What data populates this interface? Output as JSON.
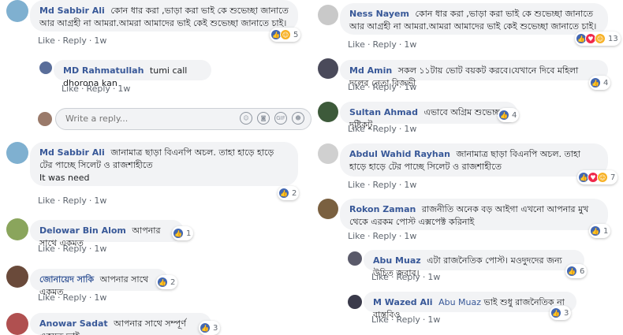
{
  "actions": {
    "like": "Like",
    "reply": "Reply",
    "dot": "·"
  },
  "colors": {
    "link": "#385898",
    "bubble": "#f2f3f5",
    "like_blue": "#4267b2"
  },
  "reply_box": {
    "placeholder": "Write a reply..."
  },
  "left": [
    {
      "author": "Md Sabbir Ali",
      "text": "কোন ধার করা ,ভাড়া করা ভাই কে শুভেচ্ছা জানাতে আর আগ্রহী না আমরা.আমরা আমাদের ভাই কেই শুভেচ্ছা জানাতে চাই।",
      "time": "1w",
      "reactions": "5",
      "icons": [
        "like-icon",
        "haha-icon"
      ]
    },
    {
      "author": "MD Rahmatullah",
      "text": "tumi call dhorona kan",
      "time": "1w"
    },
    {
      "author": "Md Sabbir Ali",
      "text": "জানামাত্র ছাড়া বিএনপি অচল. তাহা হাড়ে হাড়ে টের পাচ্ছে সিলেট ও রাজশাহীতে",
      "text2": "It was need",
      "time": "1w",
      "reactions": "2"
    },
    {
      "author": "Delowar Bin Alom",
      "text": "আপনার সাথে একমত",
      "time": "1w",
      "reactions": "1"
    },
    {
      "author": "জোনায়েদ সাকি",
      "text": "আপনার সাথে একমত",
      "time": "1w",
      "reactions": "2"
    },
    {
      "author": "Anowar Sadat",
      "text": "আপনার সাথে সম্পূর্ণ একমত ভাই...",
      "reactions": "3"
    }
  ],
  "right": [
    {
      "author": "Ness Nayem",
      "text": "কোন ধার করা ,ভাড়া করা ভাই কে শুভেচ্ছা জানাতে আর আগ্রহী না আমরা.আমরা আমাদের ভাই কেই শুভেচ্ছা জানাতে চাই।",
      "time": "1w",
      "reactions": "13",
      "icons": [
        "like-icon",
        "love-icon",
        "haha-icon"
      ]
    },
    {
      "author": "Md Amin",
      "text": "সকল ১১টায় ভোট বয়কট করবে।যেখানে দিবে মহিলা দলের নেতা রিজভী",
      "time": "1w",
      "reactions": "4"
    },
    {
      "author": "Sultan Ahmad",
      "text": "এভাবে অগ্রিম শুভেচ্ছা দৃষ্টিকটু",
      "time": "1w",
      "reactions": "4"
    },
    {
      "author": "Abdul Wahid Rayhan",
      "text": "জানামাত্র ছাড়া বিএনপি অচল. তাহা হাড়ে হাড়ে টের পাচ্ছে সিলেট ও রাজশাহীতে",
      "time": "1w",
      "reactions": "7",
      "icons": [
        "like-icon",
        "love-icon",
        "haha-icon"
      ]
    },
    {
      "author": "Rokon Zaman",
      "text": "রাজনীতি অনেক বড় আইগা এখনো আপনার মুখ থেকে এরকম পোস্ট এক্সপেক্ট করিনাই",
      "time": "1w",
      "reactions": "1"
    },
    {
      "author": "Abu Muaz",
      "text": "এটা রাজনৈতিক পোস্ট। মওদুদদের জন্য উচিত জবাব।",
      "time": "1w",
      "reactions": "6"
    },
    {
      "author": "M Wazed Ali",
      "tag": "Abu Muaz",
      "text": "ভাই শুধু রাজনৈতিক না বাস্তবিও",
      "time": "1w",
      "reactions": "3"
    }
  ]
}
